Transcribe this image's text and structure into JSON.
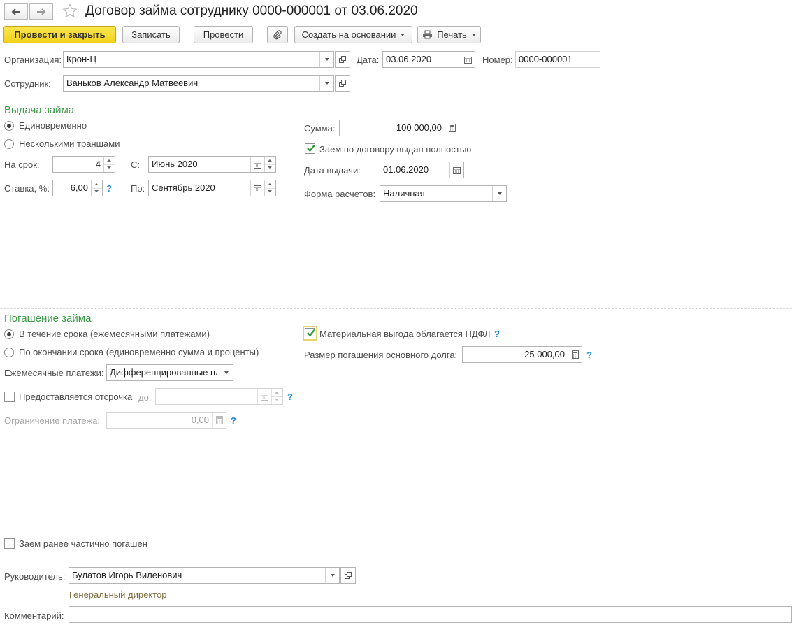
{
  "header": {
    "title": "Договор займа сотруднику 0000-000001 от 03.06.2020",
    "icons": {
      "back": "arrow-left-icon",
      "forward": "arrow-right-icon",
      "favorite": "star-icon"
    }
  },
  "toolbar": {
    "post_close": "Провести и закрыть",
    "save": "Записать",
    "post": "Провести",
    "create_based": "Создать на основании",
    "print": "Печать"
  },
  "org": {
    "label": "Организация:",
    "value": "Крон-Ц",
    "date_label": "Дата:",
    "date": "03.06.2020",
    "number_label": "Номер:",
    "number": "0000-000001"
  },
  "employee": {
    "label": "Сотрудник:",
    "value": "Ваньков Александр Матвеевич"
  },
  "issue": {
    "title": "Выдача займа",
    "opt_once": "Единовременно",
    "opt_tranches": "Несколькими траншами",
    "term_label": "На срок:",
    "term": "4",
    "from_label": "С:",
    "from": "Июнь 2020",
    "rate_label": "Ставка, %:",
    "rate": "6,00",
    "to_label": "По:",
    "to": "Сентябрь 2020",
    "sum_label": "Сумма:",
    "sum": "100 000,00",
    "fully_issued": "Заем по договору выдан полностью",
    "issue_date_label": "Дата выдачи:",
    "issue_date": "01.06.2020",
    "payment_form_label": "Форма расчетов:",
    "payment_form": "Наличная"
  },
  "repay": {
    "title": "Погашение займа",
    "opt_monthly": "В течение срока (ежемесячными платежами)",
    "opt_end": "По окончании срока (единовременно сумма и проценты)",
    "monthly_label": "Ежемесячные платежи:",
    "monthly": "Дифференцированные платежи",
    "deferral": "Предоставляется отсрочка",
    "deferral_to": "до:",
    "limit_label": "Ограничение платежа:",
    "limit": "0,00",
    "ndfl": "Материальная выгода облагается НДФЛ",
    "principal_label": "Размер погашения основного долга:",
    "principal": "25 000,00"
  },
  "footer": {
    "partial": "Заем ранее частично погашен",
    "head_label": "Руководитель:",
    "head": "Булатов Игорь Виленович",
    "head_position": "Генеральный директор",
    "comment_label": "Комментарий:",
    "comment": ""
  },
  "help_mark": "?",
  "colors": {
    "primary_button": "#f3d21b",
    "section_title": "#3a9a47",
    "help": "#1c8ad6"
  }
}
